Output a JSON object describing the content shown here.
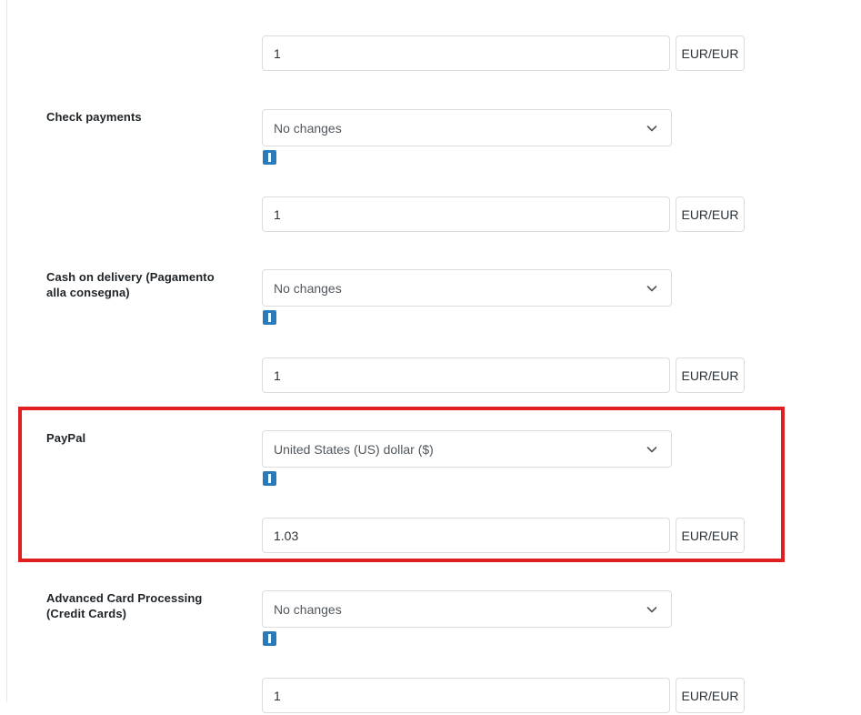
{
  "page": {
    "background_color": "#ffffff",
    "accent_info_color": "#2a7ab9",
    "highlight_color": "#e02020",
    "border_color": "#dcdcde"
  },
  "currency_unit_label": "EUR/EUR",
  "chevron_icon_name": "chevron-down-icon",
  "info_icon_name": "info-icon",
  "rows": [
    {
      "label": "",
      "has_select": false,
      "rate_value": "1",
      "unit": "EUR/EUR"
    },
    {
      "label": "Check payments",
      "has_select": true,
      "select_value": "No changes",
      "rate_value": "1",
      "unit": "EUR/EUR"
    },
    {
      "label": "Cash on delivery (Pagamento alla consegna)",
      "has_select": true,
      "select_value": "No changes",
      "rate_value": "1",
      "unit": "EUR/EUR"
    },
    {
      "label": "PayPal",
      "has_select": true,
      "select_value": "United States (US) dollar ($)",
      "rate_value": "1.03",
      "unit": "EUR/EUR",
      "highlighted": true
    },
    {
      "label": "Advanced Card Processing (Credit Cards)",
      "label_line1": "Advanced Card Processing",
      "label_line2": "(Credit Cards)",
      "has_select": true,
      "select_value": "No changes",
      "rate_value": "1",
      "unit": "EUR/EUR"
    }
  ],
  "labels": {
    "row0_label": "",
    "row1_label": "Check payments",
    "row2_label_line1": "Cash on delivery (Pagamento",
    "row2_label_line2": "alla consegna)",
    "row3_label": "PayPal",
    "row4_label_line1": "Advanced Card Processing",
    "row4_label_line2": "(Credit Cards)"
  },
  "values": {
    "rate_top": "1",
    "select_check_payments": "No changes",
    "rate_check_payments": "1",
    "select_cash_on_delivery": "No changes",
    "rate_cash_on_delivery": "1",
    "select_paypal": "United States (US) dollar ($)",
    "rate_paypal": "1.03",
    "select_advanced_card": "No changes",
    "rate_advanced_card": "1"
  }
}
